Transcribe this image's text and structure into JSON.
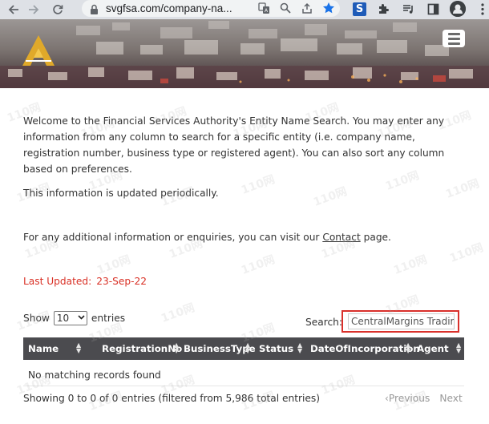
{
  "browser": {
    "url": "svgfsa.com/company-na...",
    "nav_icons": [
      "back-arrow-icon",
      "forward-arrow-icon",
      "reload-icon"
    ],
    "omnibox_icons": [
      "translate-icon",
      "zoom-icon",
      "share-icon",
      "star-icon"
    ],
    "extension_icons": [
      "s-extension-icon",
      "puzzle-icon",
      "media-icon",
      "side-panel-icon",
      "profile-avatar-icon",
      "kebab-menu-icon"
    ],
    "s_ext_letter": "S",
    "star_color": "#1a73e8"
  },
  "banner": {
    "logo": "fsa-logo",
    "menu_icon": "hamburger-menu-icon"
  },
  "intro": {
    "paragraph1": "Welcome to the Financial Services Authority's Entity Name Search. You may enter any information from any column to search for a specific entity (i.e. company name, registration number, business type or registered agent). You can also sort any column based on preferences.",
    "paragraph2": "This information is updated periodically.",
    "paragraph3_prefix": "For any additional information or enquiries, you can visit our ",
    "paragraph3_link": "Contact",
    "paragraph3_suffix": " page."
  },
  "last_updated": {
    "label": "Last Updated:",
    "date": "23-Sep-22",
    "color": "#d93025"
  },
  "table_controls": {
    "show_label": "Show",
    "entries_value": "10",
    "entries_label": "entries",
    "search_label": "Search:",
    "search_value": "CentralMargins Trading",
    "highlight_color": "#d9302b"
  },
  "table": {
    "columns": [
      "Name",
      "RegistrationNo",
      "BusinessType",
      "Status",
      "DateOfIncorporation",
      "Agent"
    ],
    "header_bg": "#4b4b4f",
    "empty_message": "No matching records found"
  },
  "footer": {
    "info": "Showing 0 to 0 of 0 entries (filtered from 5,986 total entries)",
    "previous": "Previous",
    "next": "Next"
  },
  "watermark": "110网"
}
